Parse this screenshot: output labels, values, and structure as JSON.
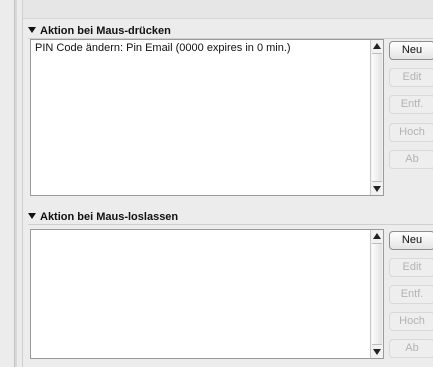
{
  "press_section": {
    "title": "Aktion bei Maus-drücken",
    "items": [
      "PIN Code ändern: Pin Email (0000 expires in 0 min.)"
    ],
    "buttons": {
      "new": "Neu",
      "edit": "Edit",
      "delete": "Entf.",
      "up": "Hoch",
      "down": "Ab"
    }
  },
  "release_section": {
    "title": "Aktion bei Maus-loslassen",
    "items": [],
    "buttons": {
      "new": "Neu",
      "edit": "Edit",
      "delete": "Entf.",
      "up": "Hoch",
      "down": "Ab"
    }
  }
}
